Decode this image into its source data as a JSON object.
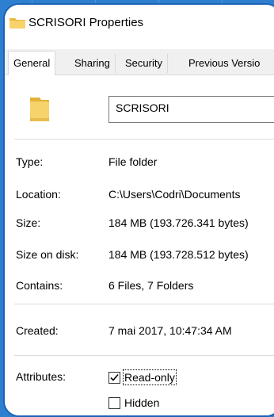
{
  "window": {
    "title": "SCRISORI Properties"
  },
  "tabs": [
    {
      "label": "General",
      "active": true
    },
    {
      "label": "Sharing",
      "active": false
    },
    {
      "label": "Security",
      "active": false
    },
    {
      "label": "Previous Versio",
      "active": false
    }
  ],
  "folder": {
    "name": "SCRISORI",
    "icon": "folder-icon"
  },
  "properties": {
    "type": {
      "label": "Type:",
      "value": "File folder"
    },
    "location": {
      "label": "Location:",
      "value": "C:\\Users\\Codri\\Documents"
    },
    "size": {
      "label": "Size:",
      "value": "184 MB (193.726.341 bytes)"
    },
    "size_on_disk": {
      "label": "Size on disk:",
      "value": "184 MB (193.728.512 bytes)"
    },
    "contains": {
      "label": "Contains:",
      "value": "6 Files, 7 Folders"
    },
    "created": {
      "label": "Created:",
      "value": "7 mai 2017, 10:47:34 AM"
    }
  },
  "attributes": {
    "label": "Attributes:",
    "read_only": {
      "label": "Read-only",
      "checked": true
    },
    "hidden": {
      "label": "Hidden",
      "checked": false
    }
  },
  "colors": {
    "accent": "#1a62b8",
    "background": "#2f7fd0",
    "folder": "#f4c542"
  }
}
